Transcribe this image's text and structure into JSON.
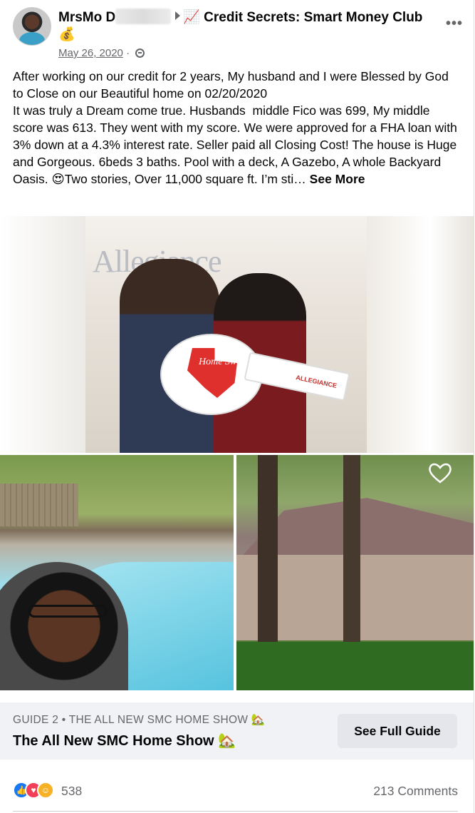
{
  "post": {
    "author_name": "MrsMo D",
    "group_name": "📈 Credit Secrets: Smart Money Club💰",
    "date": "May 26, 2020",
    "privacy_icon": "globe-icon",
    "text": "After working on our credit for 2 years, My husband and I were Blessed by God to Close on our Beautiful home on 02/20/2020\nIt was truly a Dream come true. Husbands  middle Fico was 699, My middle score was 613. They went with my score. We were approved for a FHA loan with 3% down at a 4.3% interest rate. Seller paid all Closing Cost! The house is Huge and Gorgeous. 6beds 3 baths. Pool with a deck, A Gazebo, A whole Backyard Oasis. 😍Two stories, Over 11,000 square ft. I’m sti… ",
    "see_more": "See More"
  },
  "photos": {
    "top_logo": "Allegiance",
    "key_text": "Home Sweet Home",
    "key_brand": "ALLEGIANCE"
  },
  "guide": {
    "kicker": "GUIDE 2 • THE ALL NEW SMC HOME SHOW 🏡",
    "title": "The All New SMC Home Show 🏡",
    "button": "See Full Guide"
  },
  "reactions": {
    "count": "538",
    "comments": "213 Comments"
  }
}
